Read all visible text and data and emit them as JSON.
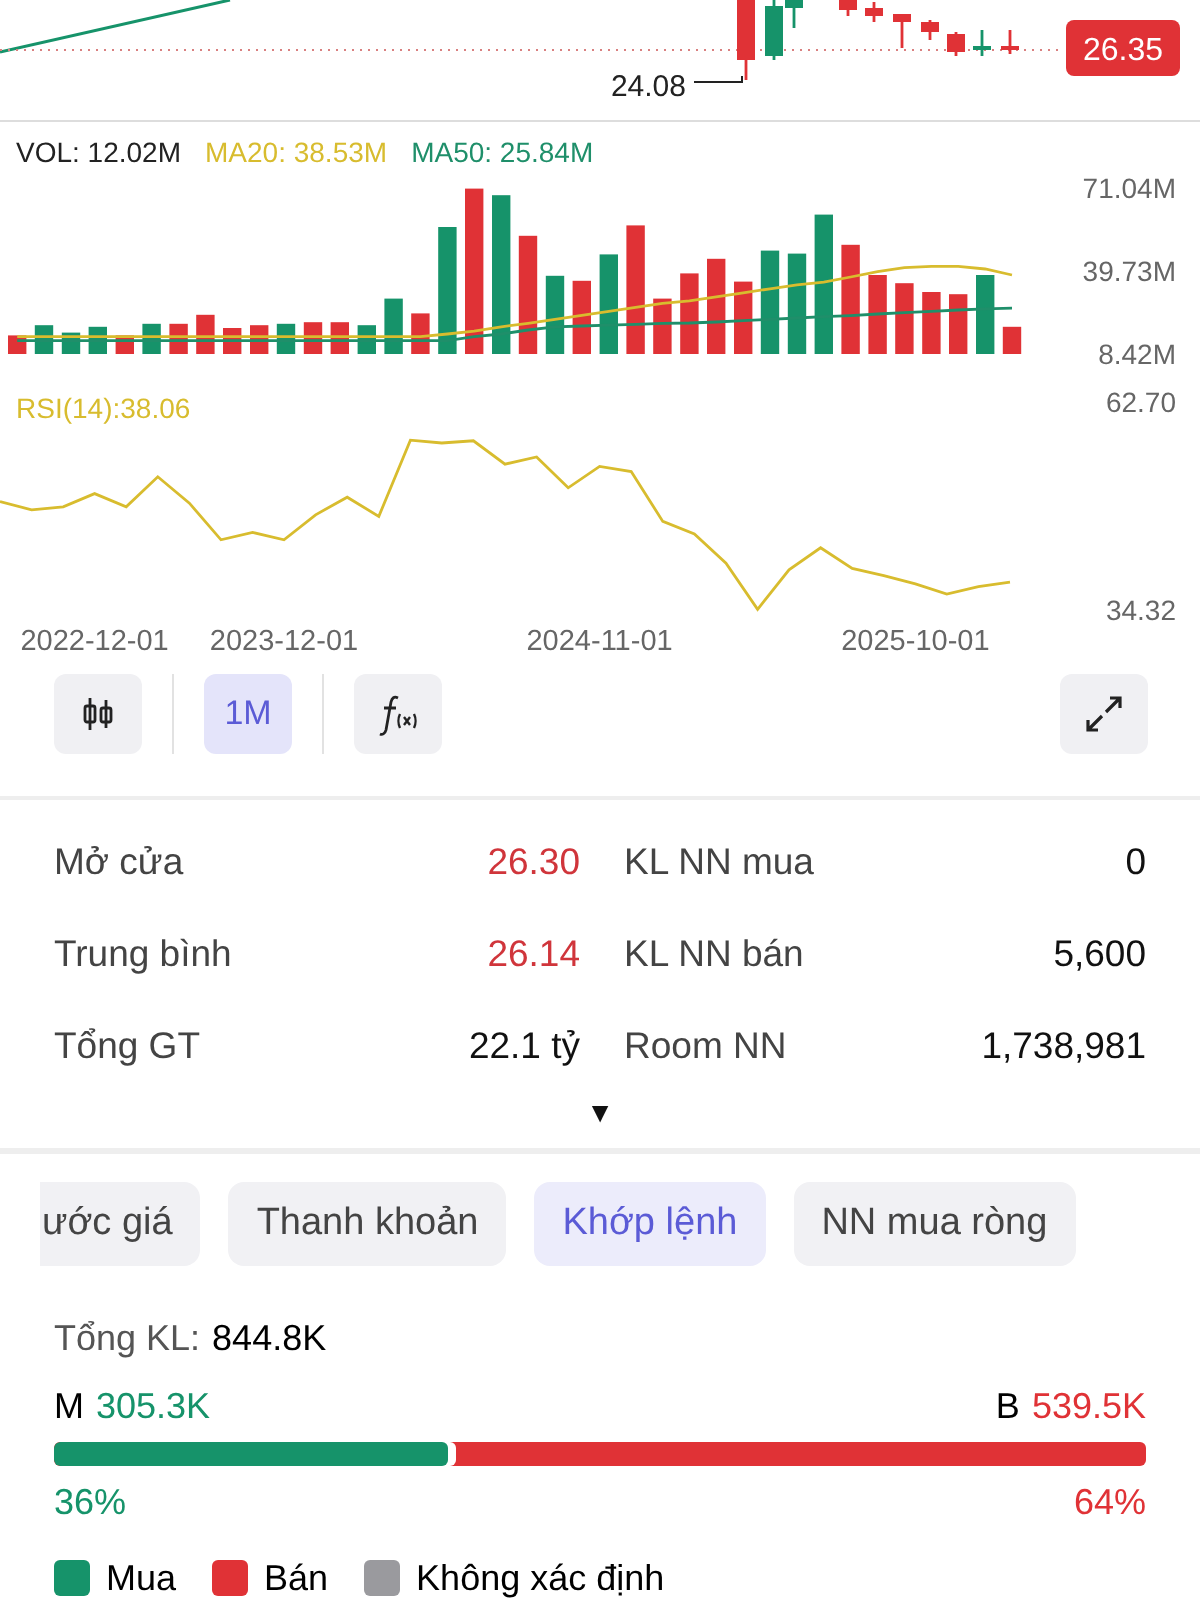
{
  "price_chart": {
    "last_price": "26.35",
    "low_label": "24.08"
  },
  "volume_chart": {
    "readouts": [
      {
        "text": "VOL: 12.02M",
        "color": "#222222"
      },
      {
        "text": "MA20: 38.53M",
        "color": "#d8bc2e"
      },
      {
        "text": "MA50: 25.84M",
        "color": "#1f8f6a"
      }
    ],
    "chart_data": {
      "type": "bar",
      "categories": [
        null,
        null,
        null,
        null,
        null,
        null,
        null,
        null,
        null,
        null,
        null,
        null,
        null,
        null,
        null,
        null,
        null,
        null,
        null,
        null,
        null,
        null,
        null,
        null,
        null,
        null,
        null,
        null,
        null,
        null,
        null,
        null,
        null,
        null,
        null,
        null,
        null,
        null
      ],
      "series": [
        {
          "color": "#16936a",
          "values": [
            null,
            19.3,
            16.5,
            18.7,
            null,
            19.8,
            null,
            null,
            null,
            null,
            19.8,
            null,
            null,
            19.3,
            29.3,
            null,
            56.3,
            null,
            68.3,
            null,
            37.9,
            null,
            46.0,
            null,
            null,
            null,
            null,
            null,
            47.4,
            46.3,
            61.0,
            null,
            null,
            null,
            null,
            null,
            38.2,
            null
          ]
        },
        {
          "color": "#e03236",
          "values": [
            15.4,
            null,
            null,
            null,
            15.4,
            null,
            19.8,
            23.2,
            18.2,
            19.3,
            null,
            20.4,
            20.4,
            null,
            null,
            23.7,
            null,
            70.8,
            null,
            53.0,
            null,
            36.0,
            null,
            56.9,
            29.3,
            38.8,
            44.3,
            35.7,
            null,
            null,
            null,
            49.6,
            38.2,
            35.1,
            31.8,
            31.0,
            null,
            18.7
          ]
        },
        {
          "type": "line",
          "color": "#d8bc2e",
          "values": [
            15.0,
            15.0,
            15.0,
            15.0,
            15.0,
            15.0,
            15.0,
            15.0,
            15.0,
            15.0,
            15.0,
            15.0,
            15.0,
            15.0,
            15.0,
            15.0,
            16.0,
            17.0,
            18.7,
            20.0,
            21.5,
            23.0,
            24.5,
            26.0,
            27.5,
            28.5,
            30.0,
            31.5,
            33.0,
            34.5,
            35.5,
            37.5,
            39.5,
            41.0,
            41.5,
            41.5,
            40.5,
            38.2
          ]
        },
        {
          "type": "line",
          "color": "#1f8f6a",
          "values": [
            13.5,
            13.5,
            13.5,
            13.5,
            13.5,
            13.5,
            13.5,
            13.5,
            13.5,
            13.5,
            13.5,
            13.5,
            13.5,
            13.5,
            13.5,
            13.5,
            13.5,
            15.0,
            16.0,
            17.5,
            18.7,
            19.0,
            19.3,
            19.6,
            20.0,
            20.1,
            20.5,
            21.0,
            21.5,
            22.0,
            22.5,
            22.9,
            23.5,
            24.0,
            24.5,
            25.0,
            25.5,
            25.7
          ]
        }
      ],
      "ylim": [
        8.42,
        71.04
      ],
      "yticks": [
        {
          "value": 71.04,
          "label": "71.04M"
        },
        {
          "value": 39.73,
          "label": "39.73M"
        },
        {
          "value": 8.42,
          "label": "8.42M"
        }
      ]
    }
  },
  "rsi_chart": {
    "label": "RSI(14):38.06",
    "chart_data": {
      "type": "line",
      "categories": [
        null,
        null,
        null,
        "2022-12-01",
        null,
        null,
        null,
        null,
        null,
        "2023-12-01",
        null,
        null,
        null,
        null,
        null,
        null,
        null,
        null,
        null,
        "2024-11-01",
        null,
        null,
        null,
        null,
        null,
        null,
        null,
        null,
        null,
        "2025-10-01",
        null,
        null,
        null
      ],
      "series": [
        {
          "color": "#d8bc2e",
          "values": [
            49.1,
            48.0,
            48.4,
            50.2,
            48.4,
            52.5,
            48.9,
            43.9,
            44.9,
            43.9,
            47.3,
            49.7,
            47.1,
            57.5,
            57.1,
            57.4,
            54.2,
            55.2,
            51.0,
            53.9,
            53.2,
            46.4,
            44.7,
            40.7,
            34.4,
            39.8,
            42.8,
            40.0,
            39.0,
            37.9,
            36.5,
            37.5,
            38.1
          ]
        }
      ],
      "ylim": [
        34.32,
        62.7
      ],
      "yticks": [
        {
          "value": 62.7,
          "label": "62.70"
        },
        {
          "value": 34.32,
          "label": "34.32"
        }
      ]
    }
  },
  "toolbar": [
    {
      "kind": "chart_type",
      "selected": false
    },
    {
      "kind": "period",
      "label": "1M",
      "selected": true
    },
    {
      "kind": "indicators",
      "selected": false
    },
    {
      "kind": "fullscreen",
      "selected": false
    }
  ],
  "stats": [
    {
      "label": "Mở cửa",
      "value": "26.30",
      "color": "#d0353b"
    },
    {
      "label": "KL NN mua",
      "value": "0",
      "color": "#111111"
    },
    {
      "label": "Trung bình",
      "value": "26.14",
      "color": "#d0353b"
    },
    {
      "label": "KL NN bán",
      "value": "5,600",
      "color": "#111111"
    },
    {
      "label": "Tổng GT",
      "value": "22.1 tỷ",
      "color": "#111111"
    },
    {
      "label": "Room NN",
      "value": "1,738,981",
      "color": "#111111"
    }
  ],
  "expand_toggle": "▼",
  "tabs": [
    {
      "label": "ước giá",
      "selected": false
    },
    {
      "label": "Thanh khoản",
      "selected": false
    },
    {
      "label": "Khớp lệnh",
      "selected": true
    },
    {
      "label": "NN mua ròng",
      "selected": false
    }
  ],
  "match_summary": {
    "total_label": "Tổng KL:",
    "total_value": "844.8K",
    "buy": {
      "letter": "M",
      "value": "305.3K",
      "percent": "36%",
      "level": 0.36,
      "color": "#16936a"
    },
    "sell": {
      "letter": "B",
      "value": "539.5K",
      "percent": "64%",
      "color": "#e03236"
    }
  },
  "legend": [
    {
      "label": "Mua",
      "color": "#16936a"
    },
    {
      "label": "Bán",
      "color": "#e03236"
    },
    {
      "label": "Không xác định",
      "color": "#9a9a9e"
    }
  ]
}
